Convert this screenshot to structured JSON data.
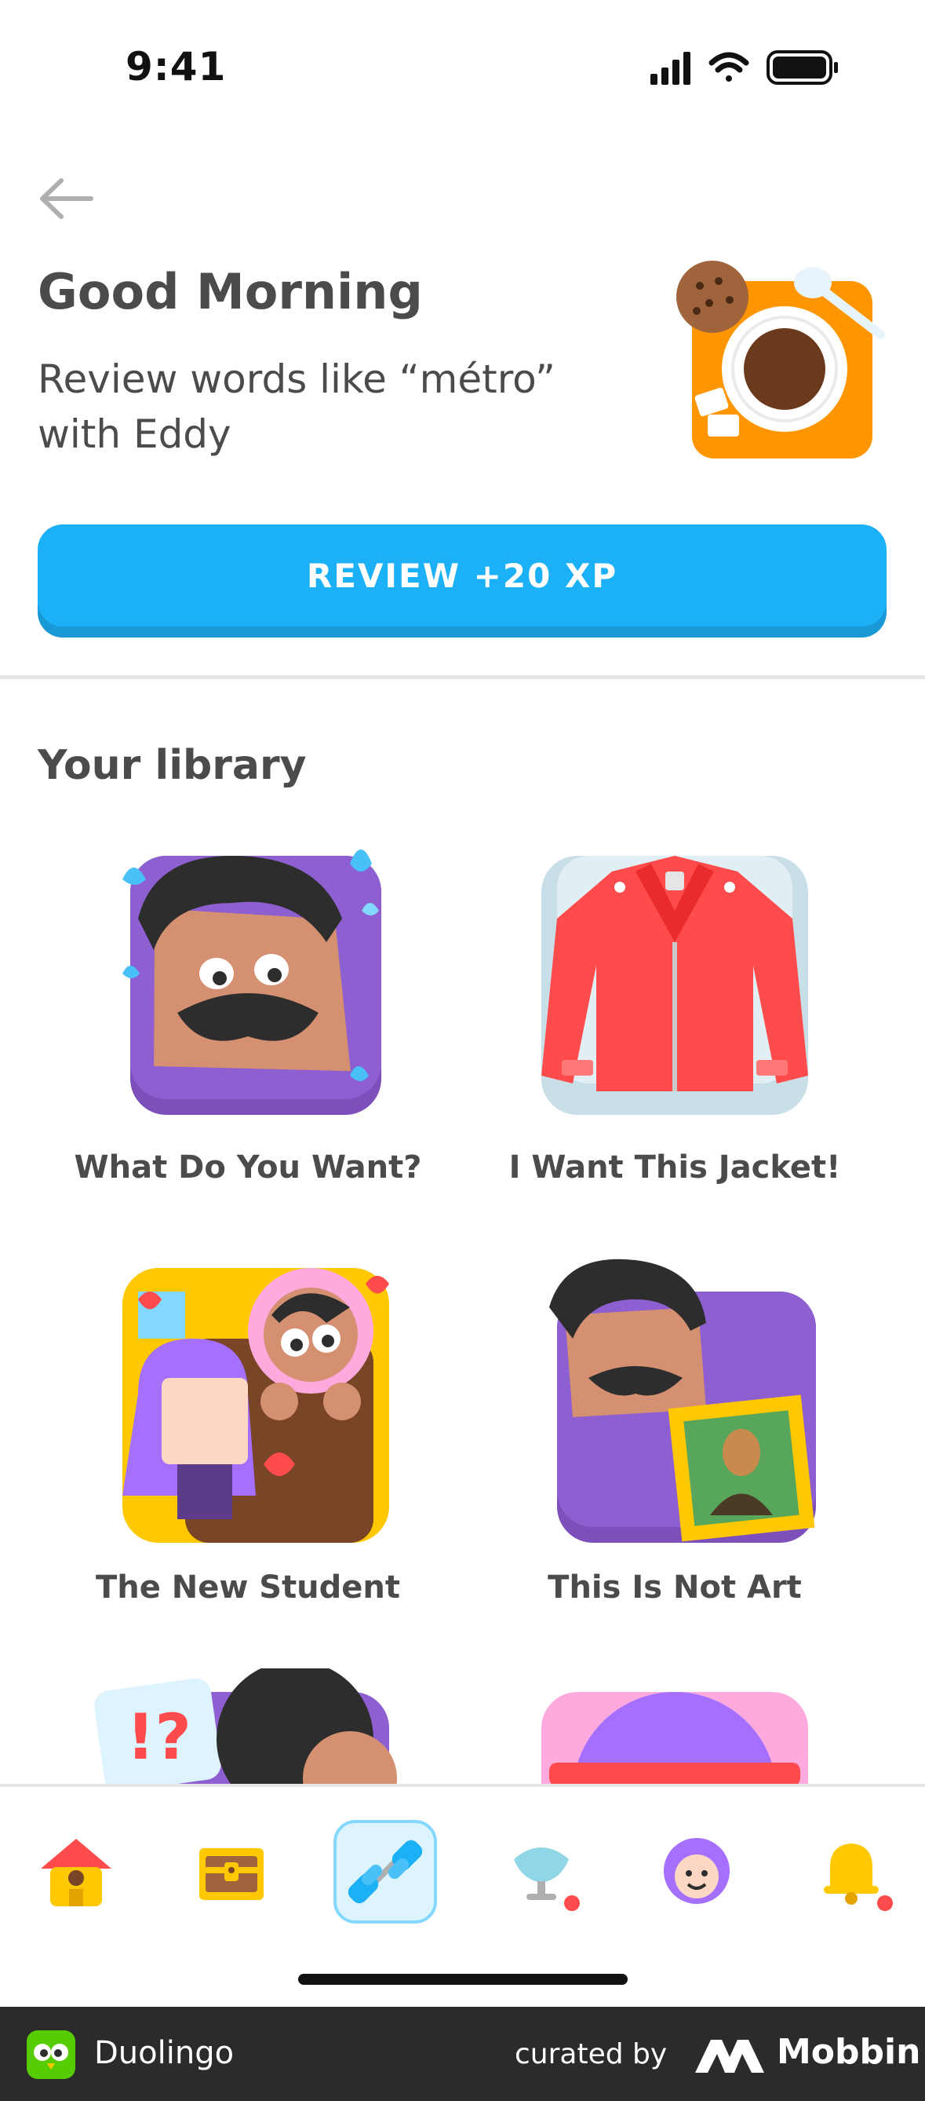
{
  "status_bar": {
    "time": "9:41"
  },
  "header": {
    "title": "Good Morning",
    "subtitle": "Review words like “métro” with Eddy",
    "review_button": "REVIEW +20 XP"
  },
  "library": {
    "title": "Your library",
    "stories": [
      {
        "title": "What Do You Want?"
      },
      {
        "title": "I Want This Jacket!"
      },
      {
        "title": "The New Student"
      },
      {
        "title": "This Is Not Art"
      }
    ]
  },
  "tabbar": {
    "items": [
      "home-icon",
      "treasure-chest-icon",
      "dumbbell-icon",
      "shop-icon",
      "profile-icon",
      "bell-icon"
    ],
    "active": "dumbbell-icon"
  },
  "footer": {
    "app_name": "Duolingo",
    "curated_by": "curated by",
    "brand": "Mobbin"
  },
  "colors": {
    "accent": "#1cb0f6",
    "accent_shadow": "#1899d6",
    "text": "#4b4b4b",
    "footer_bg": "#2b2b2b"
  }
}
